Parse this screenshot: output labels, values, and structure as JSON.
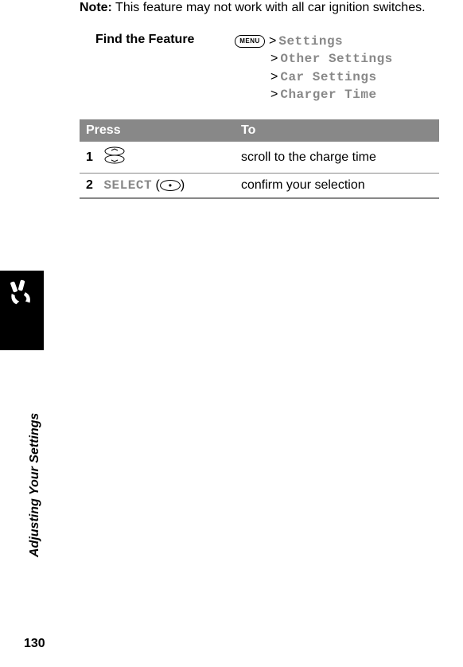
{
  "note": {
    "label": "Note:",
    "text": " This feature may not work with all car ignition switches."
  },
  "findFeature": {
    "label": "Find the Feature",
    "menuKey": "MENU",
    "path": [
      "Settings",
      "Other Settings",
      "Car Settings",
      "Charger Time"
    ]
  },
  "table": {
    "headers": {
      "press": "Press",
      "to": "To"
    },
    "rows": [
      {
        "step": "1",
        "press_type": "scroll",
        "to": "scroll to the charge time"
      },
      {
        "step": "2",
        "press_type": "select",
        "press_label": "SELECT",
        "to": "confirm your selection"
      }
    ]
  },
  "sectionTitle": "Adjusting Your Settings",
  "pageNumber": "130"
}
